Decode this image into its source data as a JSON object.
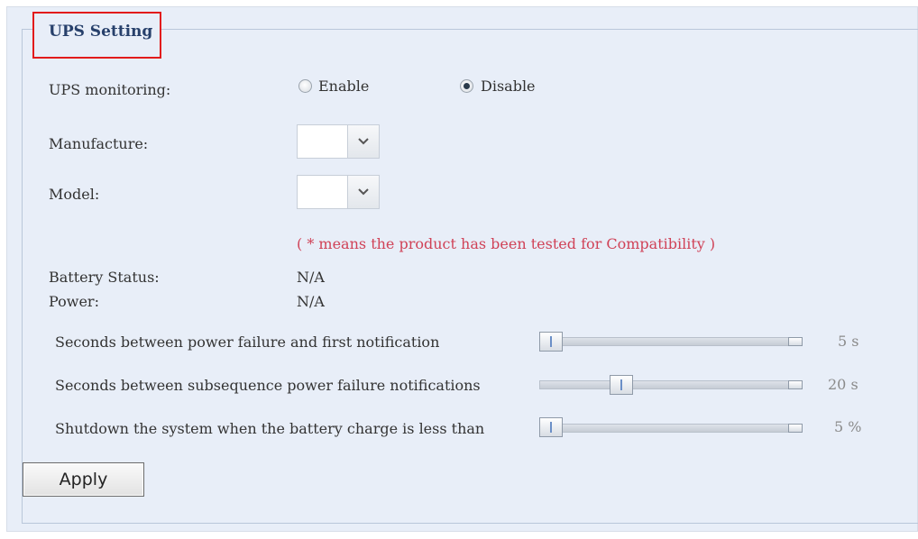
{
  "section": {
    "title": "UPS Setting"
  },
  "ups_monitoring": {
    "label": "UPS monitoring:",
    "options": [
      {
        "label": "Enable",
        "checked": false
      },
      {
        "label": "Disable",
        "checked": true
      }
    ]
  },
  "manufacture": {
    "label": "Manufacture:",
    "value": ""
  },
  "model": {
    "label": "Model:",
    "value": ""
  },
  "compat_note": "( * means the product has been tested for Compatibility )",
  "battery_status": {
    "label": "Battery Status:",
    "value": "N/A"
  },
  "power": {
    "label": "Power:",
    "value": "N/A"
  },
  "sliders": [
    {
      "label": "Seconds between power failure and first notification",
      "value_text": "5 s",
      "level": 0.0
    },
    {
      "label": "Seconds between subsequence power failure notifications",
      "value_text": "20 s",
      "level": 0.3
    },
    {
      "label": "Shutdown the system when the battery charge is less than",
      "value_text": "5 %",
      "level": 0.0
    }
  ],
  "apply_label": "Apply",
  "colors": {
    "legend_box": "#e21b1b",
    "title": "#27406b",
    "note": "#d04257",
    "panel": "#e8eef8"
  },
  "icons": {
    "select_arrow": "chevron-down-icon"
  }
}
